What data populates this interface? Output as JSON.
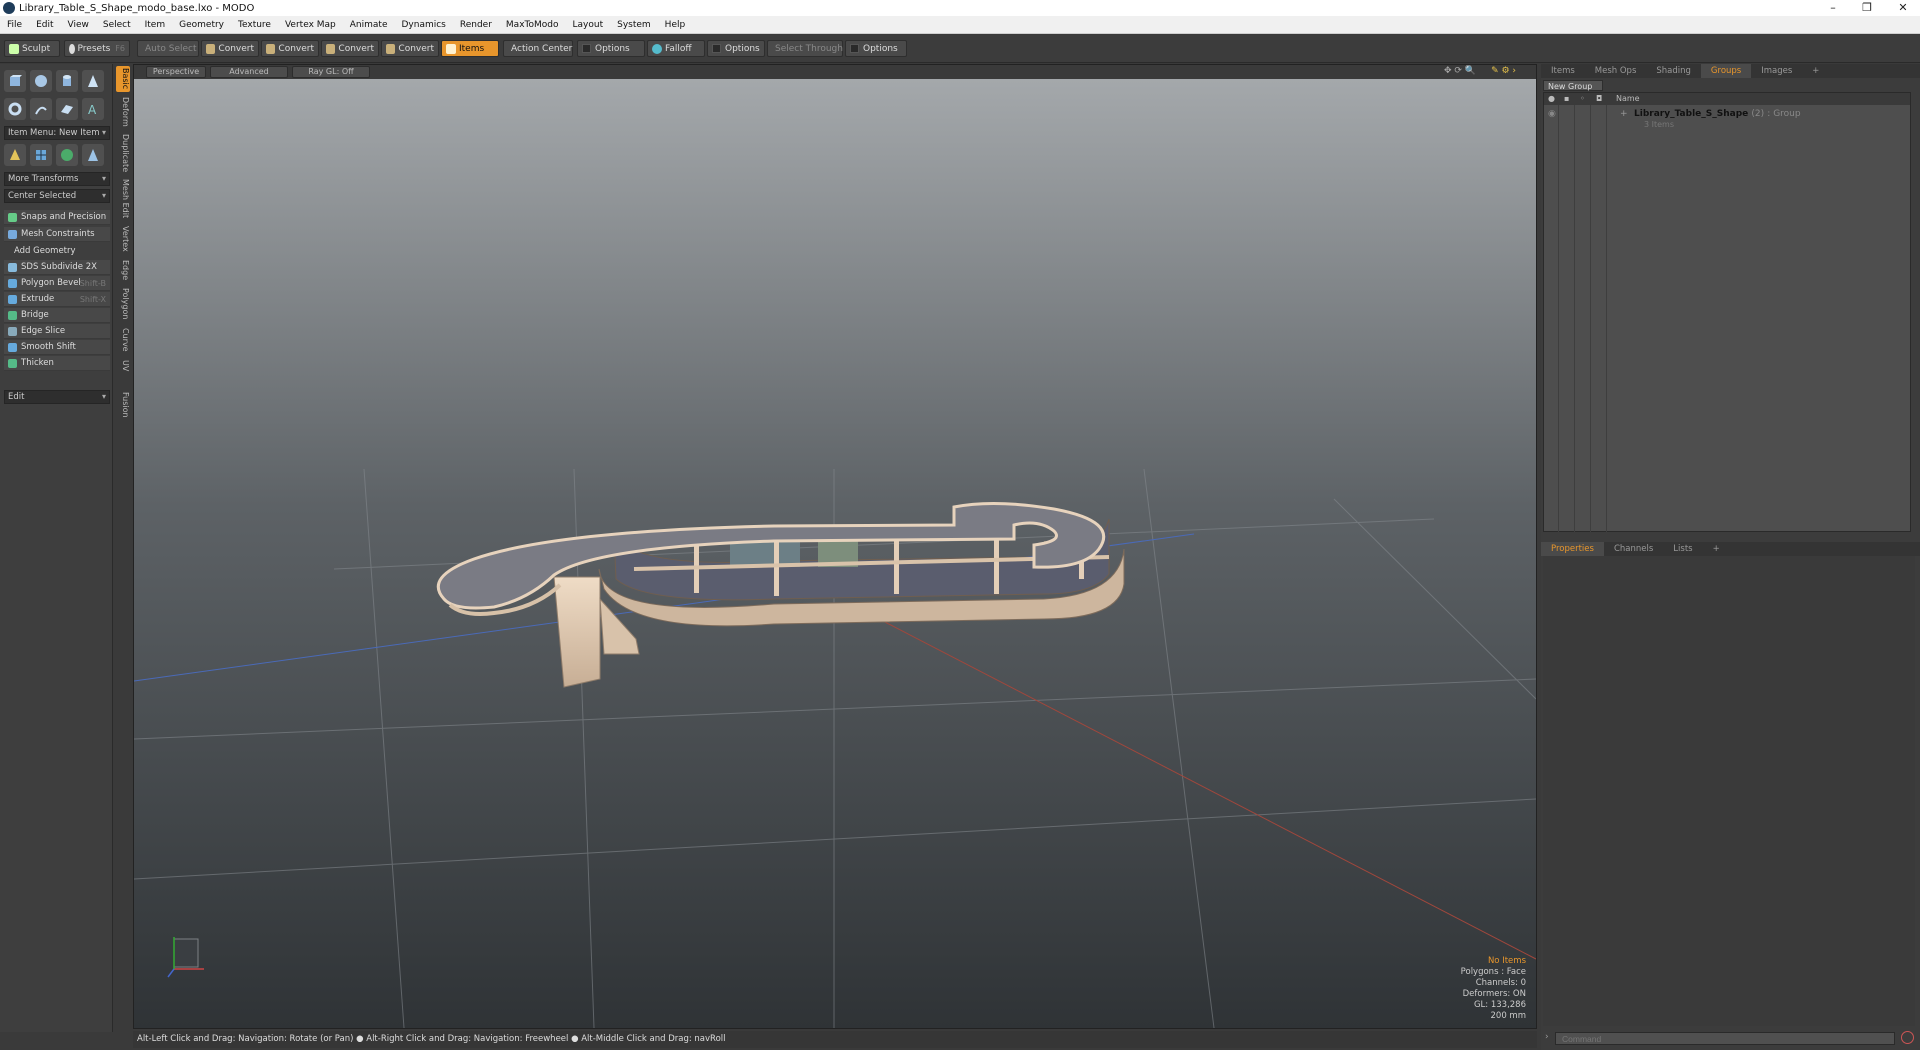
{
  "window": {
    "title": "Library_Table_S_Shape_modo_base.lxo - MODO"
  },
  "menu": [
    "File",
    "Edit",
    "View",
    "Select",
    "Item",
    "Geometry",
    "Texture",
    "Vertex Map",
    "Animate",
    "Dynamics",
    "Render",
    "MaxToModo",
    "Layout",
    "System",
    "Help"
  ],
  "toolbar": {
    "sculpt": "Sculpt",
    "presets": "Presets",
    "presets_key": "F6",
    "auto_select": "Auto Select",
    "convert": "Convert",
    "items": "Items",
    "action_center": "Action Center",
    "options": "Options",
    "falloff": "Falloff",
    "select_through": "Select Through"
  },
  "left_panel": {
    "vtabs": [
      "Basic",
      "Deform",
      "Duplicate",
      "Mesh Edit",
      "Vertex",
      "Edge",
      "Polygon",
      "Curve",
      "UV",
      "Fusion"
    ],
    "item_menu": "Item Menu: New Item",
    "more_transforms": "More Transforms",
    "center_selected": "Center Selected",
    "snaps": "Snaps and Precision",
    "mesh_constraints": "Mesh Constraints",
    "add_geometry": "Add Geometry",
    "tools": [
      {
        "label": "SDS Subdivide 2X",
        "shortcut": ""
      },
      {
        "label": "Polygon Bevel",
        "shortcut": "Shift-B"
      },
      {
        "label": "Extrude",
        "shortcut": "Shift-X"
      },
      {
        "label": "Bridge",
        "shortcut": ""
      },
      {
        "label": "Edge Slice",
        "shortcut": ""
      },
      {
        "label": "Smooth Shift",
        "shortcut": ""
      },
      {
        "label": "Thicken",
        "shortcut": ""
      }
    ],
    "edit": "Edit"
  },
  "viewport": {
    "view": "Perspective",
    "mode": "Advanced",
    "raygl": "Ray GL: Off",
    "stats": {
      "items": "No Items",
      "polygons": "Polygons : Face",
      "channels": "Channels: 0",
      "deformers": "Deformers: ON",
      "gl": "GL: 133,286",
      "scale": "200 mm"
    }
  },
  "status": "Alt-Left Click and Drag: Navigation: Rotate (or Pan) ● Alt-Right Click and Drag: Navigation: Freewheel ● Alt-Middle Click and Drag: navRoll",
  "right_panel": {
    "tabs_top": [
      "Items",
      "Mesh Ops",
      "Shading",
      "Groups",
      "Images"
    ],
    "new_group": "New Group",
    "col_name": "Name",
    "group_name": "Library_Table_S_Shape",
    "group_count": "(2)",
    "group_type": ": Group",
    "group_items": "3 Items",
    "tabs_bottom": [
      "Properties",
      "Channels",
      "Lists"
    ],
    "command_placeholder": "Command"
  },
  "colors": {
    "accent": "#e8962c",
    "viewport_top": "#9ea3a6",
    "viewport_bottom": "#2f3336",
    "table_wood": "#e6d2bc",
    "table_top": "#77777f"
  }
}
